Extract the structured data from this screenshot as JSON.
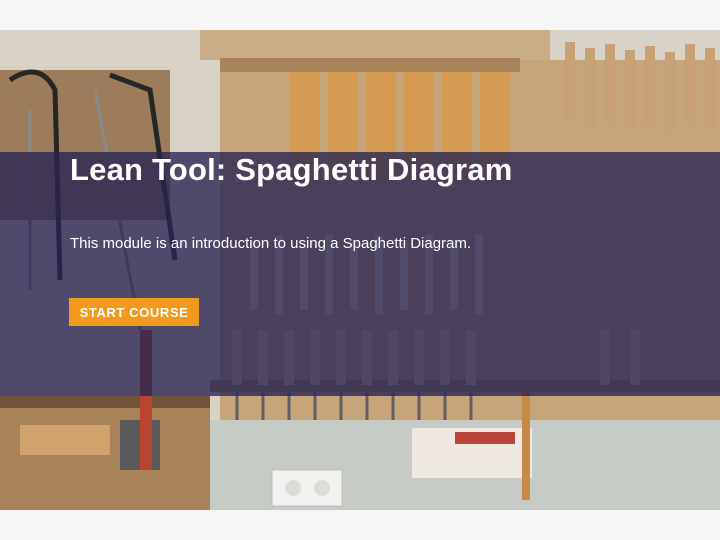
{
  "course": {
    "title": "Lean Tool: Spaghetti Diagram",
    "description": "This module is an introduction to using a Spaghetti Diagram.",
    "start_label": "START COURSE"
  },
  "colors": {
    "overlay": "#282452",
    "accent": "#f39a1e",
    "page_background": "#f6f6f7"
  }
}
